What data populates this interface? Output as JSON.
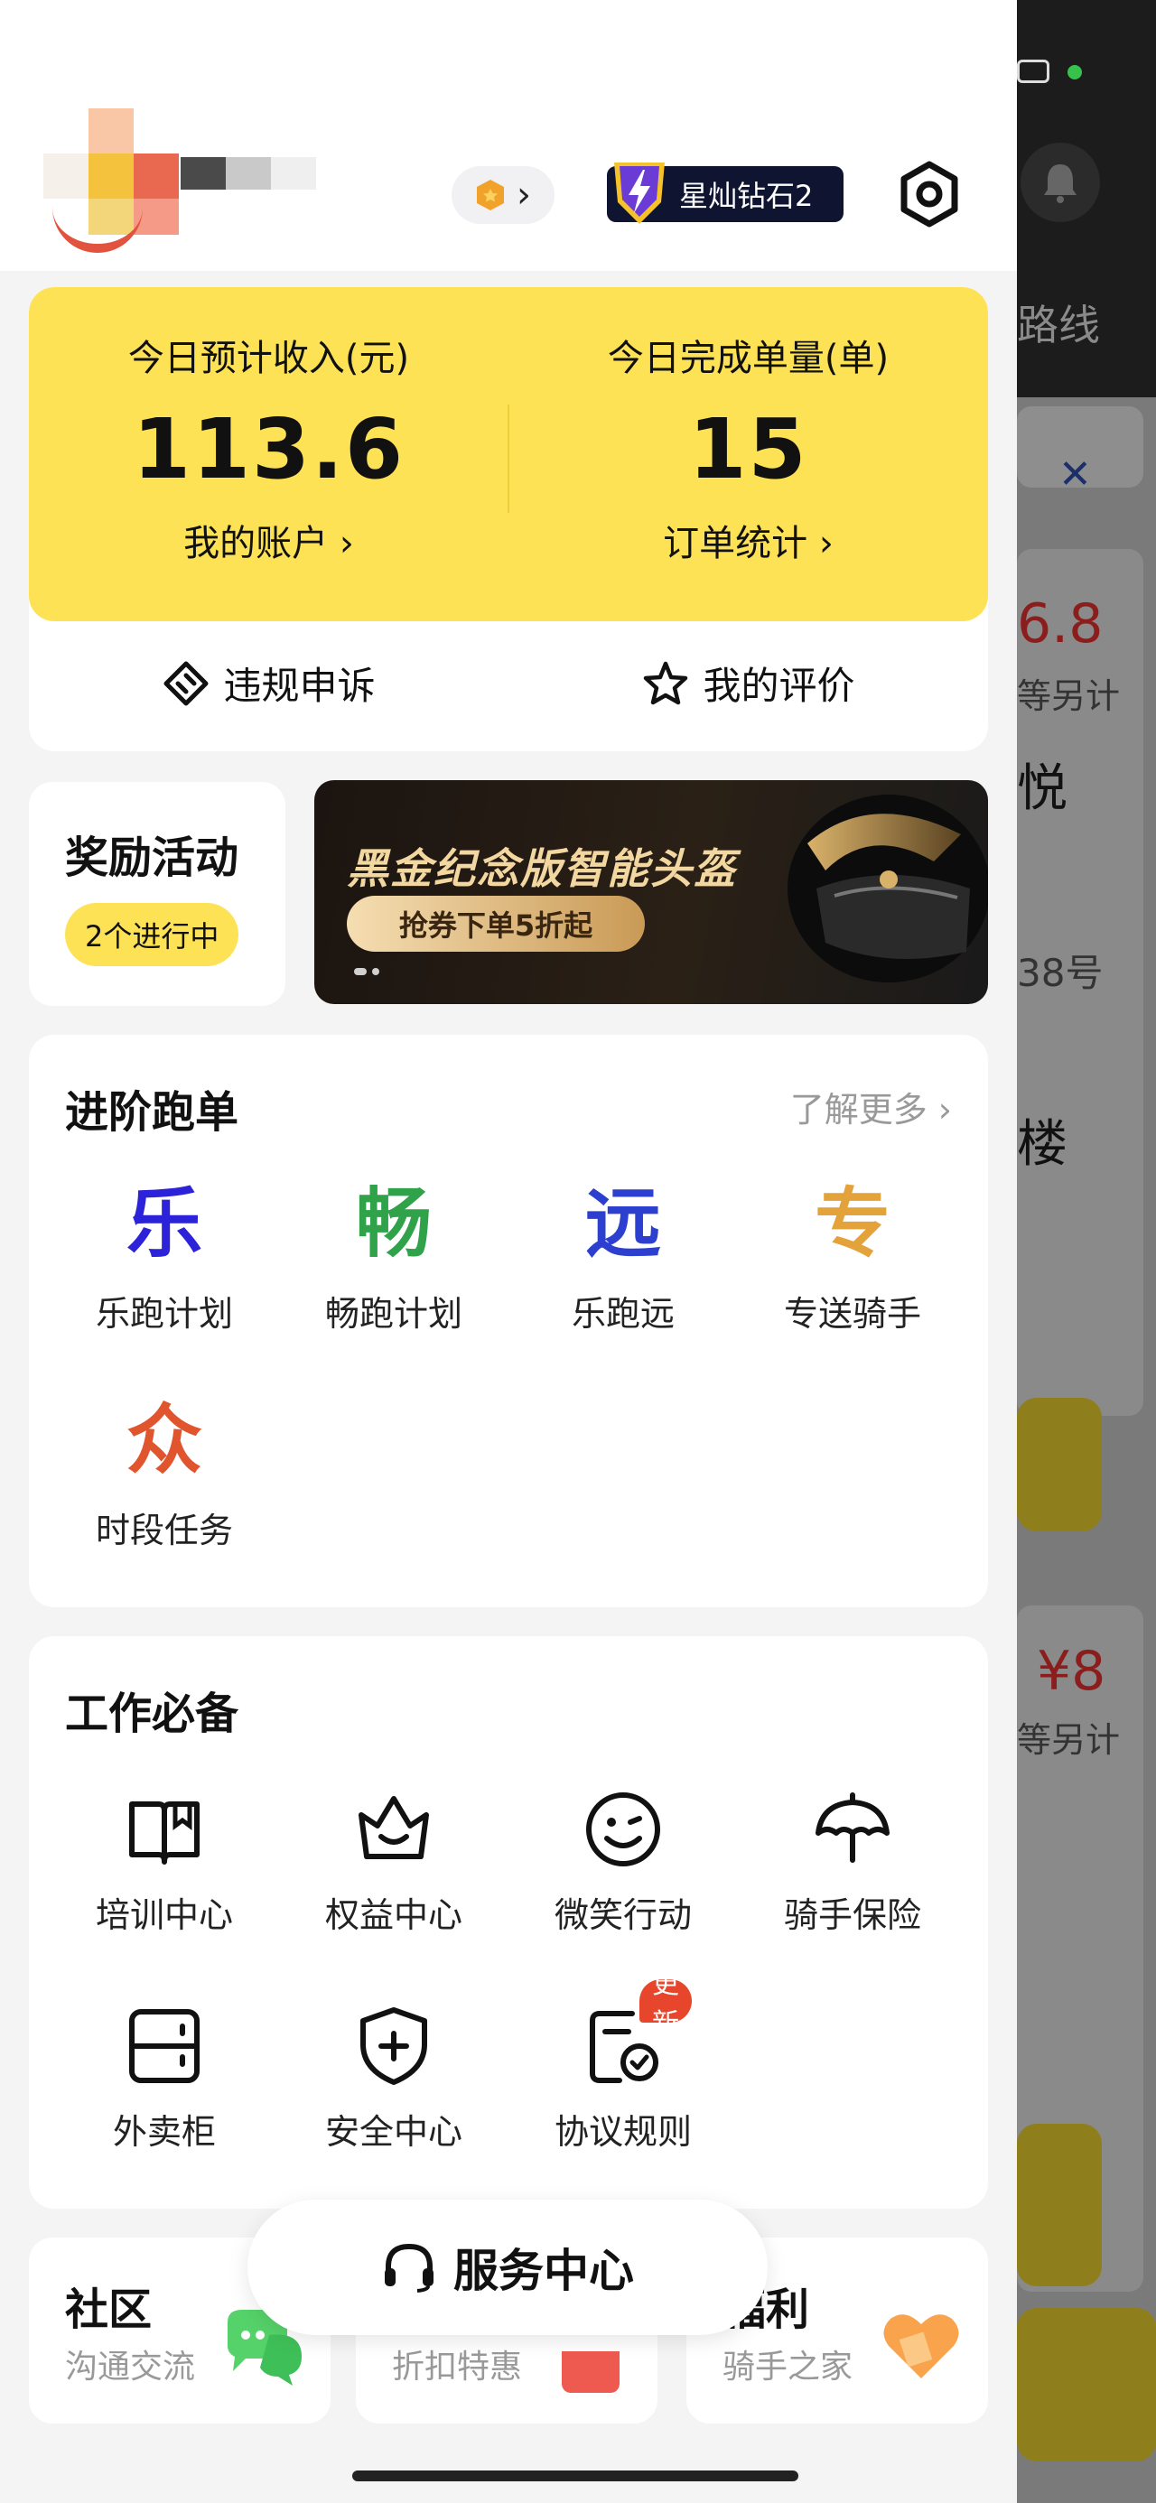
{
  "header": {
    "coin_chevron": "›",
    "level_badge": "星灿钻石2"
  },
  "income": {
    "estimated_income_label": "今日预计收入(元)",
    "estimated_income_value": "113.6",
    "account_link": "我的账户 ›",
    "orders_label": "今日完成单量(单)",
    "orders_value": "15",
    "order_stats_link": "订单统计 ›",
    "appeal_label": "违规申诉",
    "rating_label": "我的评价"
  },
  "rewards": {
    "title": "奖励活动",
    "status_pill": "2个进行中"
  },
  "banner": {
    "title": "黑金纪念版智能头盔",
    "button": "抢券下单5折起"
  },
  "advanced": {
    "title": "进阶跑单",
    "more": "了解更多 ›",
    "items": [
      {
        "glyph": "乐",
        "label": "乐跑计划",
        "color": "#2b22d9"
      },
      {
        "glyph": "畅",
        "label": "畅跑计划",
        "color": "#2fa24a"
      },
      {
        "glyph": "远",
        "label": "乐跑远",
        "color": "#2d3fcf"
      },
      {
        "glyph": "专",
        "label": "专送骑手",
        "color": "#e3a33a"
      },
      {
        "glyph": "众",
        "label": "时段任务",
        "color": "#e0552d"
      }
    ]
  },
  "essentials": {
    "title": "工作必备",
    "items": [
      {
        "label": "培训中心",
        "icon": "book-icon"
      },
      {
        "label": "权益中心",
        "icon": "crown-icon"
      },
      {
        "label": "微笑行动",
        "icon": "smile-icon"
      },
      {
        "label": "骑手保险",
        "icon": "umbrella-icon"
      },
      {
        "label": "外卖柜",
        "icon": "locker-icon"
      },
      {
        "label": "安全中心",
        "icon": "shield-icon"
      },
      {
        "label": "协议规则",
        "icon": "agreement-icon"
      }
    ],
    "update_badge": "更新"
  },
  "bottom": {
    "community_title": "社区",
    "community_sub": "沟通交流",
    "discount_sub": "折扣特惠",
    "welfare_title": "福利",
    "welfare_sub": "骑手之家"
  },
  "service_center": "服务中心",
  "background_app": {
    "route": "路线",
    "price_1": "6.8",
    "sub_1": "等另计",
    "char_1": "悦",
    "addr": "38号",
    "char_2": "楼",
    "price_2": "¥8",
    "sub_2": "等另计"
  },
  "colors": {
    "accent_yellow": "#fde256",
    "badge_navy": "#0f1430",
    "update_red": "#e8462c"
  }
}
